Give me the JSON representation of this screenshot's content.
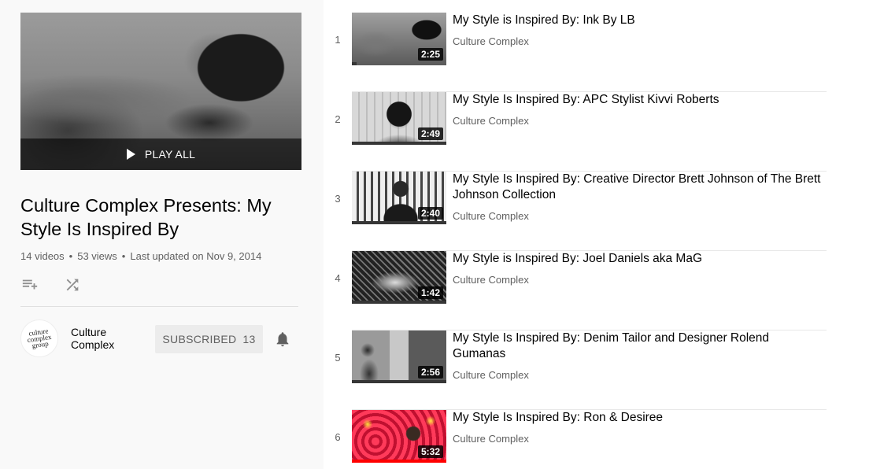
{
  "playlist": {
    "play_all_label": "PLAY ALL",
    "title": "Culture Complex Presents: My Style Is Inspired By",
    "video_count": "14 videos",
    "views": "53 views",
    "updated": "Last updated on Nov 9, 2014",
    "stats_separator": "•"
  },
  "owner": {
    "name": "Culture Complex",
    "avatar_text": "culture complex group",
    "subscribe_label": "SUBSCRIBED",
    "subscriber_count": "13"
  },
  "icons": {
    "add_to_queue": "playlist-add-icon",
    "shuffle": "shuffle-icon",
    "notifications": "bell-icon",
    "play": "play-icon"
  },
  "colors": {
    "progress": "#ff0000",
    "sidebar_bg": "#f9f9f9",
    "subscribe_bg": "#ececec"
  },
  "videos": [
    {
      "index": "1",
      "title": "My Style is Inspired By: Ink By LB",
      "channel": "Culture Complex",
      "duration": "2:25",
      "watched": 0.05
    },
    {
      "index": "2",
      "title": "My Style Is Inspired By: APC Stylist Kivvi Roberts",
      "channel": "Culture Complex",
      "duration": "2:49",
      "watched": 1.0
    },
    {
      "index": "3",
      "title": "My Style Is Inspired By: Creative Director Brett Johnson of The Brett Johnson Collection",
      "channel": "Culture Complex",
      "duration": "2:40",
      "watched": 1.0
    },
    {
      "index": "4",
      "title": "My Style is Inspired By: Joel Daniels aka MaG",
      "channel": "Culture Complex",
      "duration": "1:42",
      "watched": 1.0
    },
    {
      "index": "5",
      "title": "My Style Is Inspired By: Denim Tailor and Designer Rolend Gumanas",
      "channel": "Culture Complex",
      "duration": "2:56",
      "watched": 1.0
    },
    {
      "index": "6",
      "title": "My Style Is Inspired By: Ron & Desiree",
      "channel": "Culture Complex",
      "duration": "5:32",
      "watched": 1.0
    }
  ]
}
